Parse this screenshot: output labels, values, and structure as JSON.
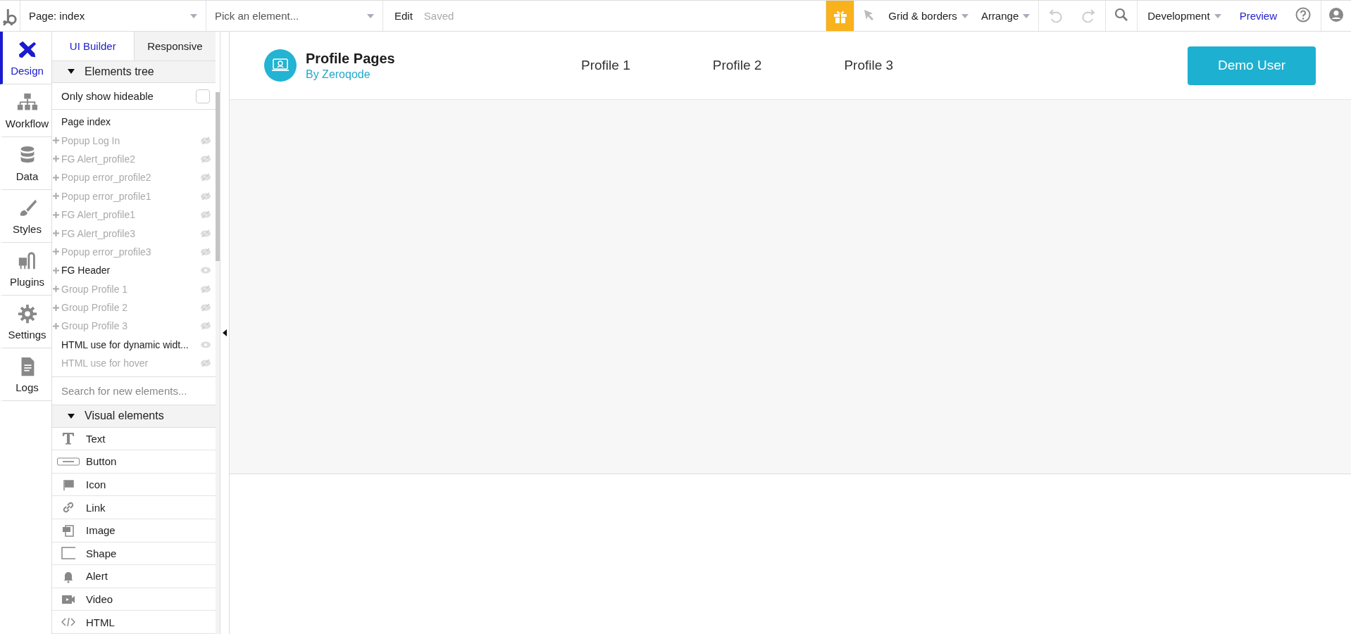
{
  "topbar": {
    "page": "Page: index",
    "element_picker": "Pick an element...",
    "edit": "Edit",
    "status": "Saved",
    "grid_menu": "Grid & borders",
    "arrange_menu": "Arrange",
    "undo": {
      "disabled": true
    },
    "redo": {
      "disabled": true
    },
    "environment": "Development",
    "preview": "Preview"
  },
  "rail": {
    "items": [
      {
        "label": "Design",
        "kind": "design",
        "selected": true
      },
      {
        "label": "Workflow",
        "kind": "workflow",
        "selected": false
      },
      {
        "label": "Data",
        "kind": "data",
        "selected": false
      },
      {
        "label": "Styles",
        "kind": "styles",
        "selected": false
      },
      {
        "label": "Plugins",
        "kind": "plugins",
        "selected": false
      },
      {
        "label": "Settings",
        "kind": "settings",
        "selected": false
      },
      {
        "label": "Logs",
        "kind": "logs",
        "selected": false
      }
    ]
  },
  "panel": {
    "tabs": [
      {
        "label": "UI Builder",
        "selected": true
      },
      {
        "label": "Responsive",
        "selected": false
      }
    ],
    "tree_section": {
      "label": "Elements tree",
      "expanded": true
    },
    "only_show_hideable": {
      "label": "Only show hideable",
      "checked": false
    },
    "tree": [
      {
        "label": "Page index",
        "children": [
          {
            "label": "Popup Log In",
            "has_children": true,
            "visible": false
          },
          {
            "label": "FG Alert_profile2",
            "has_children": true,
            "visible": false
          },
          {
            "label": "Popup error_profile2",
            "has_children": true,
            "visible": false
          },
          {
            "label": "Popup error_profile1",
            "has_children": true,
            "visible": false
          },
          {
            "label": "FG Alert_profile1",
            "has_children": true,
            "visible": false
          },
          {
            "label": "FG Alert_profile3",
            "has_children": true,
            "visible": false
          },
          {
            "label": "Popup error_profile3",
            "has_children": true,
            "visible": false
          },
          {
            "label": "FG Header",
            "has_children": true,
            "visible": true
          },
          {
            "label": "Group Profile 1",
            "has_children": true,
            "visible": false
          },
          {
            "label": "Group Profile 2",
            "has_children": true,
            "visible": false
          },
          {
            "label": "Group Profile 3",
            "has_children": true,
            "visible": false
          },
          {
            "label": "HTML use for dynamic widt...",
            "has_children": false,
            "visible": true
          },
          {
            "label": "HTML use for hover",
            "has_children": false,
            "visible": false
          }
        ]
      }
    ],
    "search": {
      "placeholder": "Search for new elements..."
    },
    "elements_section": {
      "label": "Visual elements",
      "expanded": true
    },
    "elements": [
      {
        "label": "Text",
        "kind": "text"
      },
      {
        "label": "Button",
        "kind": "button"
      },
      {
        "label": "Icon",
        "kind": "icon"
      },
      {
        "label": "Link",
        "kind": "link"
      },
      {
        "label": "Image",
        "kind": "image"
      },
      {
        "label": "Shape",
        "kind": "shape"
      },
      {
        "label": "Alert",
        "kind": "alert"
      },
      {
        "label": "Video",
        "kind": "video"
      },
      {
        "label": "HTML",
        "kind": "html"
      }
    ]
  },
  "canvas": {
    "header": {
      "title": "Profile Pages",
      "subtitle": "By Zeroqode",
      "nav": [
        "Profile 1",
        "Profile 2",
        "Profile 3"
      ],
      "button": "Demo User"
    }
  }
}
